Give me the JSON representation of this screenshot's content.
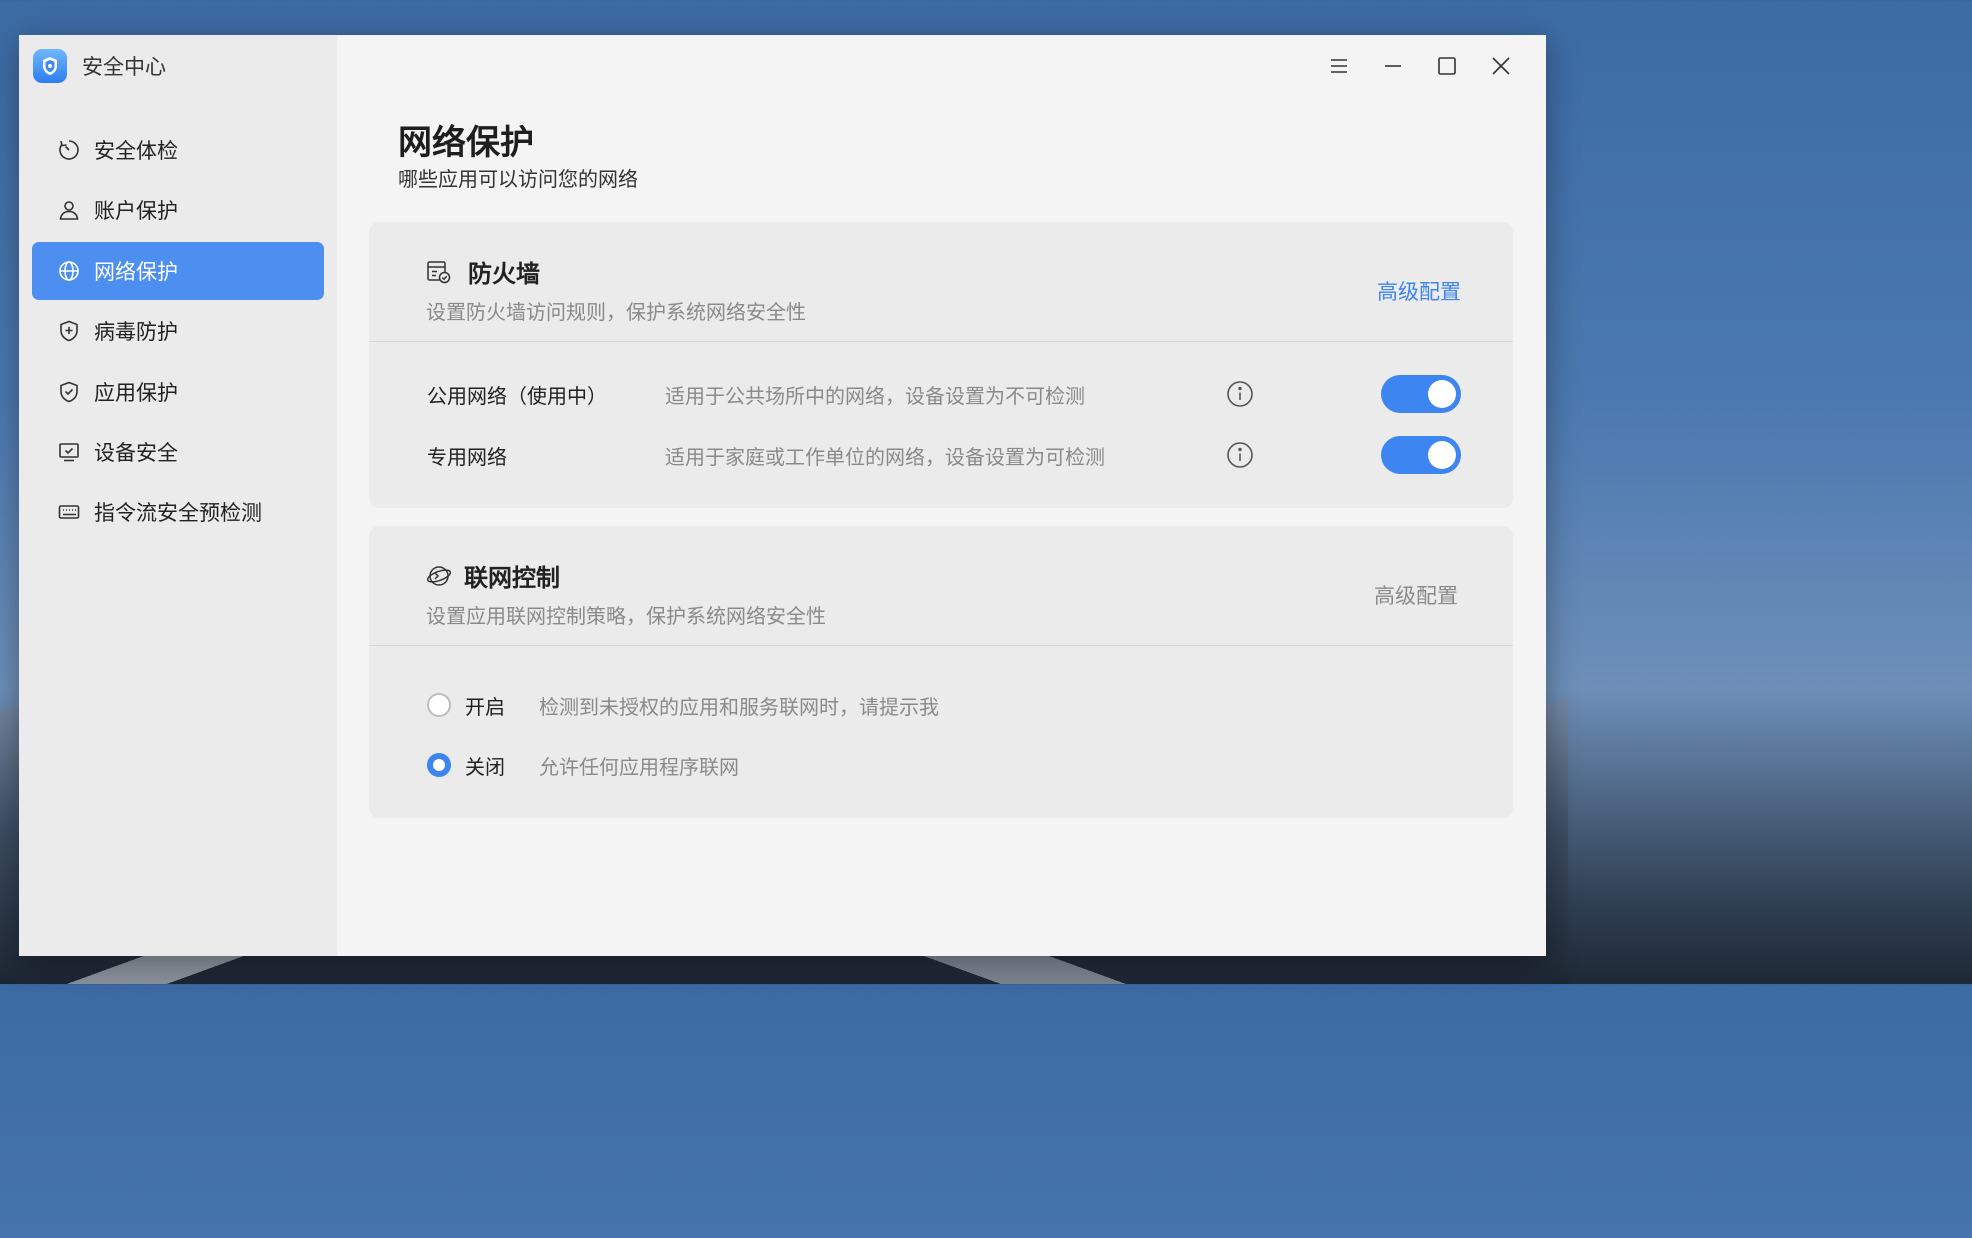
{
  "app": {
    "title": "安全中心"
  },
  "colors": {
    "accent": "#3d85f0",
    "sidebar_active": "#4d8ff0"
  },
  "sidebar": {
    "items": [
      {
        "label": "安全体检",
        "icon": "scan-icon",
        "active": false
      },
      {
        "label": "账户保护",
        "icon": "user-icon",
        "active": false
      },
      {
        "label": "网络保护",
        "icon": "globe-icon",
        "active": true
      },
      {
        "label": "病毒防护",
        "icon": "shield-plus-icon",
        "active": false
      },
      {
        "label": "应用保护",
        "icon": "shield-check-icon",
        "active": false
      },
      {
        "label": "设备安全",
        "icon": "monitor-check-icon",
        "active": false
      },
      {
        "label": "指令流安全预检测",
        "icon": "keyboard-icon",
        "active": false
      }
    ]
  },
  "page": {
    "title": "网络保护",
    "subtitle": "哪些应用可以访问您的网络"
  },
  "firewall": {
    "title": "防火墙",
    "description": "设置防火墙访问规则，保护系统网络安全性",
    "advanced_label": "高级配置",
    "networks": [
      {
        "name": "公用网络（使用中）",
        "description": "适用于公共场所中的网络，设备设置为不可检测",
        "enabled": true
      },
      {
        "name": "专用网络",
        "description": "适用于家庭或工作单位的网络，设备设置为可检测",
        "enabled": true
      }
    ]
  },
  "network_control": {
    "title": "联网控制",
    "description": "设置应用联网控制策略，保护系统网络安全性",
    "advanced_label": "高级配置",
    "options": [
      {
        "label": "开启",
        "description": "检测到未授权的应用和服务联网时，请提示我",
        "selected": false
      },
      {
        "label": "关闭",
        "description": "允许任何应用程序联网",
        "selected": true
      }
    ]
  }
}
